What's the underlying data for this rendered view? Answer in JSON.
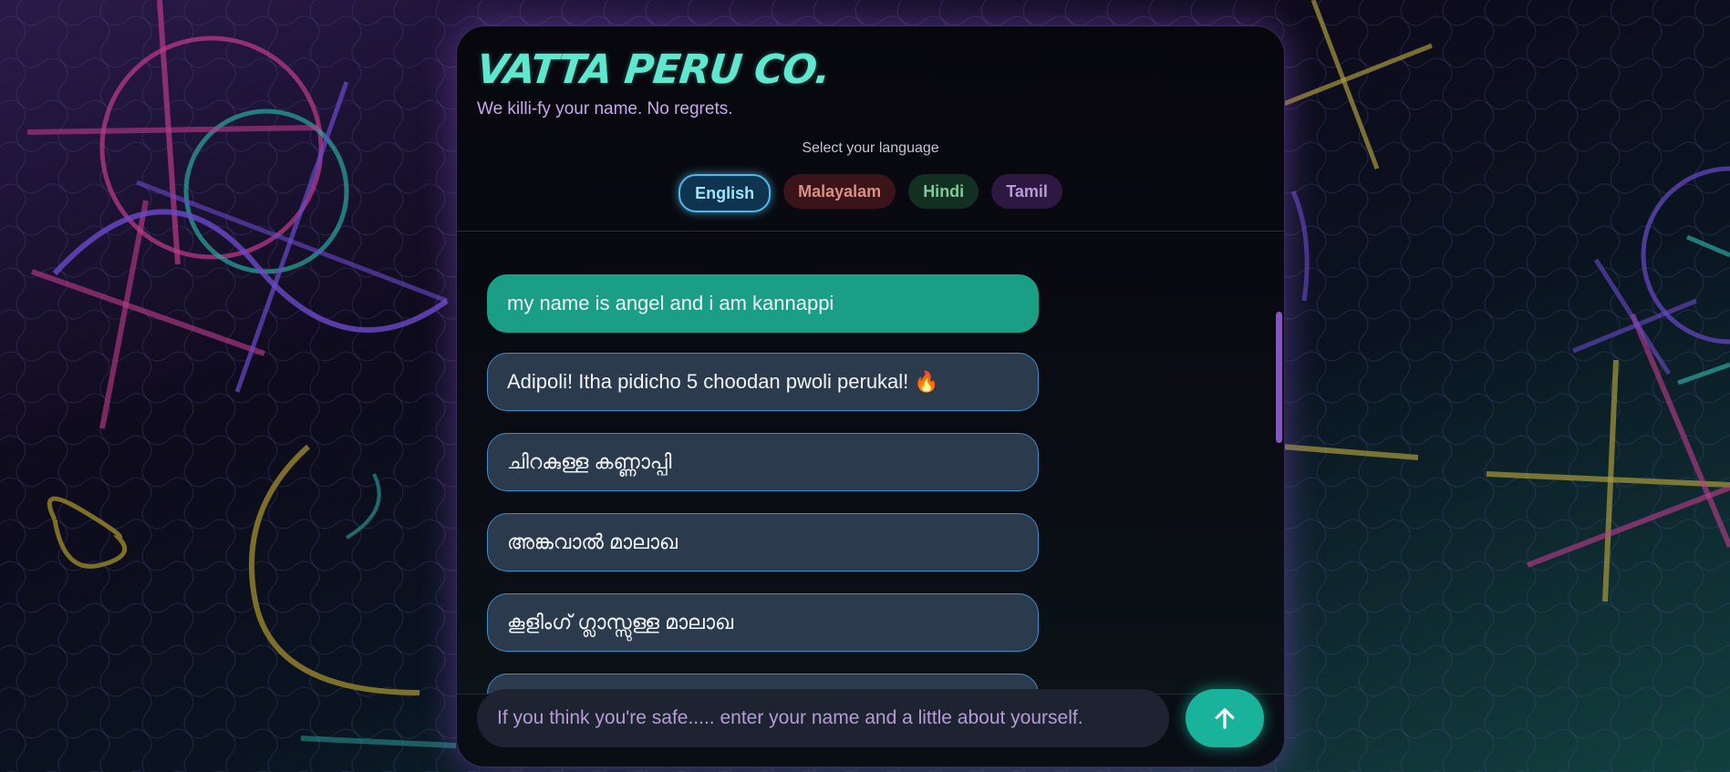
{
  "brand": {
    "title": "VATTA PERU CO.",
    "tagline": "We killi-fy your name. No regrets."
  },
  "language_selector": {
    "label": "Select your language",
    "selected": "English",
    "options": [
      "English",
      "Malayalam",
      "Hindi",
      "Tamil"
    ]
  },
  "chat": {
    "messages": [
      {
        "role": "user",
        "text": "my name is angel and i am kannappi"
      },
      {
        "role": "bot",
        "text": "Adipoli! Itha pidicho 5 choodan pwoli perukal! 🔥"
      },
      {
        "role": "bot",
        "text": "ചിറകുള്ള കണ്ണാപ്പി"
      },
      {
        "role": "bot",
        "text": "അങ്കവാൽ മാലാഖ"
      },
      {
        "role": "bot",
        "text": "കൂളിംഗ് ഗ്ലാസ്സുള്ള മാലാഖ"
      },
      {
        "role": "bot",
        "text": ""
      }
    ]
  },
  "composer": {
    "placeholder": "If you think you're safe..... enter your name and a little about yourself.",
    "send_icon": "arrow-up-icon"
  },
  "colors": {
    "accent_teal": "#19b29b",
    "title_teal": "#5ee8cf",
    "bubble_bot": "#2b3a4c",
    "bubble_border": "#3f8ecc",
    "scrollbar": "#8a52c9"
  }
}
